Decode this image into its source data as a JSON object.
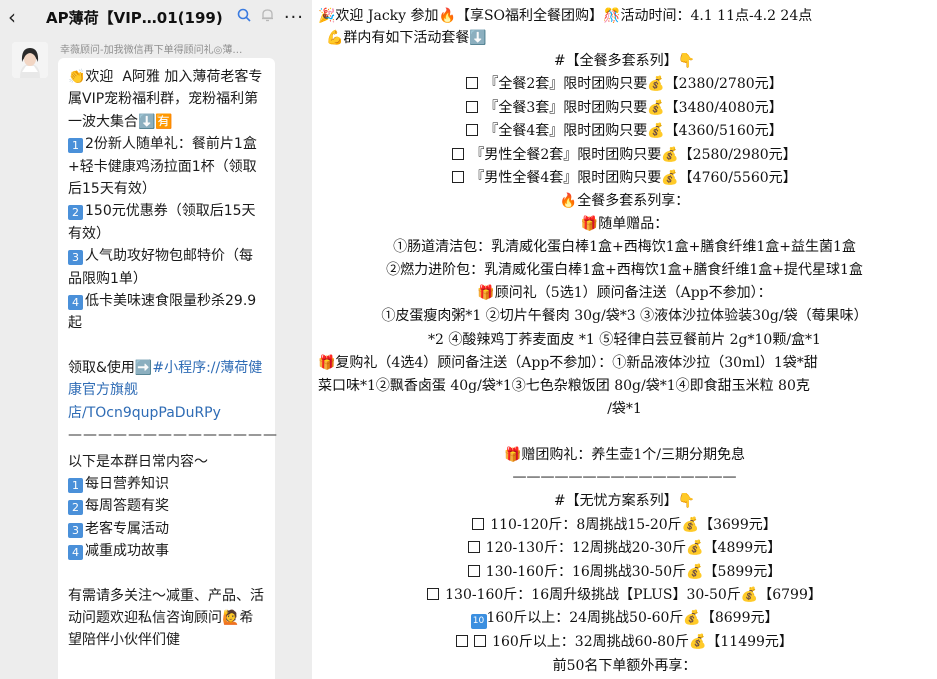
{
  "chat": {
    "back_icon": "chevron-left-icon",
    "title": "AP薄荷【VIP…01(199)",
    "search_icon": "search-icon",
    "mute_icon": "bell-mute-icon",
    "more_label": "···",
    "sender_label": "幸薇顾问-加我微信再下单得顾问礼◎薄…",
    "message": {
      "intro": "👏欢迎  A阿雅 加入薄荷老客专属VIP宠粉福利群，宠粉福利第一波大集合⬇️🈶",
      "items": [
        {
          "num": "1",
          "text": "2份新人随单礼：餐前片1盒+轻卡健康鸡汤拉面1杯（领取后15天有效）"
        },
        {
          "num": "2",
          "text": "150元优惠券（领取后15天有效）"
        },
        {
          "num": "3",
          "text": "人气助攻好物包邮特价（每品限购1单）"
        },
        {
          "num": "4",
          "text": "低卡美味速食限量秒杀29.9起"
        }
      ],
      "claim_prefix": "领取&使用➡️",
      "claim_link": "#小程序://薄荷健康官方旗舰店/TOcn9qupPaDuRPy",
      "separator": "——————————————",
      "daily_title": "以下是本群日常内容～",
      "daily": [
        {
          "num": "1",
          "text": "每日营养知识"
        },
        {
          "num": "2",
          "text": "每周答题有奖"
        },
        {
          "num": "3",
          "text": "老客专属活动"
        },
        {
          "num": "4",
          "text": "减重成功故事"
        }
      ],
      "outro": "有需请多关注～减重、产品、活动问题欢迎私信咨询顾问🙋希望陪伴小伙伴们健"
    }
  },
  "poster": {
    "l1": "🎉欢迎 Jacky 参加🔥【享SO福利全餐团购】🎊活动时间：4.1 11点-4.2 24点",
    "l2": "💪群内有如下活动套餐⬇️",
    "l3": "#【全餐多套系列】👇",
    "packs": [
      {
        "n": "1",
        "text": "『全餐2套』限时团购只要💰【2380/2780元】"
      },
      {
        "n": "2",
        "text": "『全餐3套』限时团购只要💰【3480/4080元】"
      },
      {
        "n": "3",
        "text": "『全餐4套』限时团购只要💰【4360/5160元】"
      },
      {
        "n": "4",
        "text": "『男性全餐2套』限时团购只要💰【2580/2980元】"
      },
      {
        "n": "5",
        "text": "『男性全餐4套』限时团购只要💰【4760/5560元】"
      }
    ],
    "l9": "🔥全餐多套系列享：",
    "l10": "🎁随单赠品：",
    "l11": "①肠道清洁包：乳清威化蛋白棒1盒+西梅饮1盒+膳食纤维1盒+益生菌1盒",
    "l12": "②燃力进阶包：乳清威化蛋白棒1盒+西梅饮1盒+膳食纤维1盒+提代星球1盒",
    "l13": "🎁顾问礼（5选1）顾问备注送（App不参加）：",
    "l14": "①皮蛋瘦肉粥*1 ②切片午餐肉 30g/袋*3 ③液体沙拉体验装30g/袋（莓果味）",
    "l15": "*2 ④酸辣鸡丁荞麦面皮 *1 ⑤轻律白芸豆餐前片 2g*10颗/盒*1",
    "l16": "🎁复购礼（4选4）顾问备注送（App不参加）：①新品液体沙拉（30ml）1袋*甜",
    "l17": "菜口味*1②飘香卤蛋 40g/袋*1③七色杂粮饭团 80g/袋*1④即食甜玉米粒 80克",
    "l18": "/袋*1",
    "l19": "🎁赠团购礼：养生壶1个/三期分期免息",
    "l20": "————————————————",
    "l21": "#【无忧方案系列】👇",
    "plans": [
      {
        "n": "6",
        "text": "110-120斤：8周挑战15-20斤💰【3699元】"
      },
      {
        "n": "7",
        "text": "120-130斤：12周挑战20-30斤💰【4899元】"
      },
      {
        "n": "8",
        "text": "130-160斤：16周挑战30-50斤💰【5899元】"
      },
      {
        "n": "9",
        "text": "130-160斤：16周升级挑战【PLUS】30-50斤💰【6799】"
      },
      {
        "n": "10",
        "text": "160斤以上：24周挑战50-60斤💰【8699元】"
      },
      {
        "n": "11",
        "text": "160斤以上：32周挑战60-80斤💰【11499元】"
      }
    ],
    "l28": "前50名下单额外再享："
  }
}
